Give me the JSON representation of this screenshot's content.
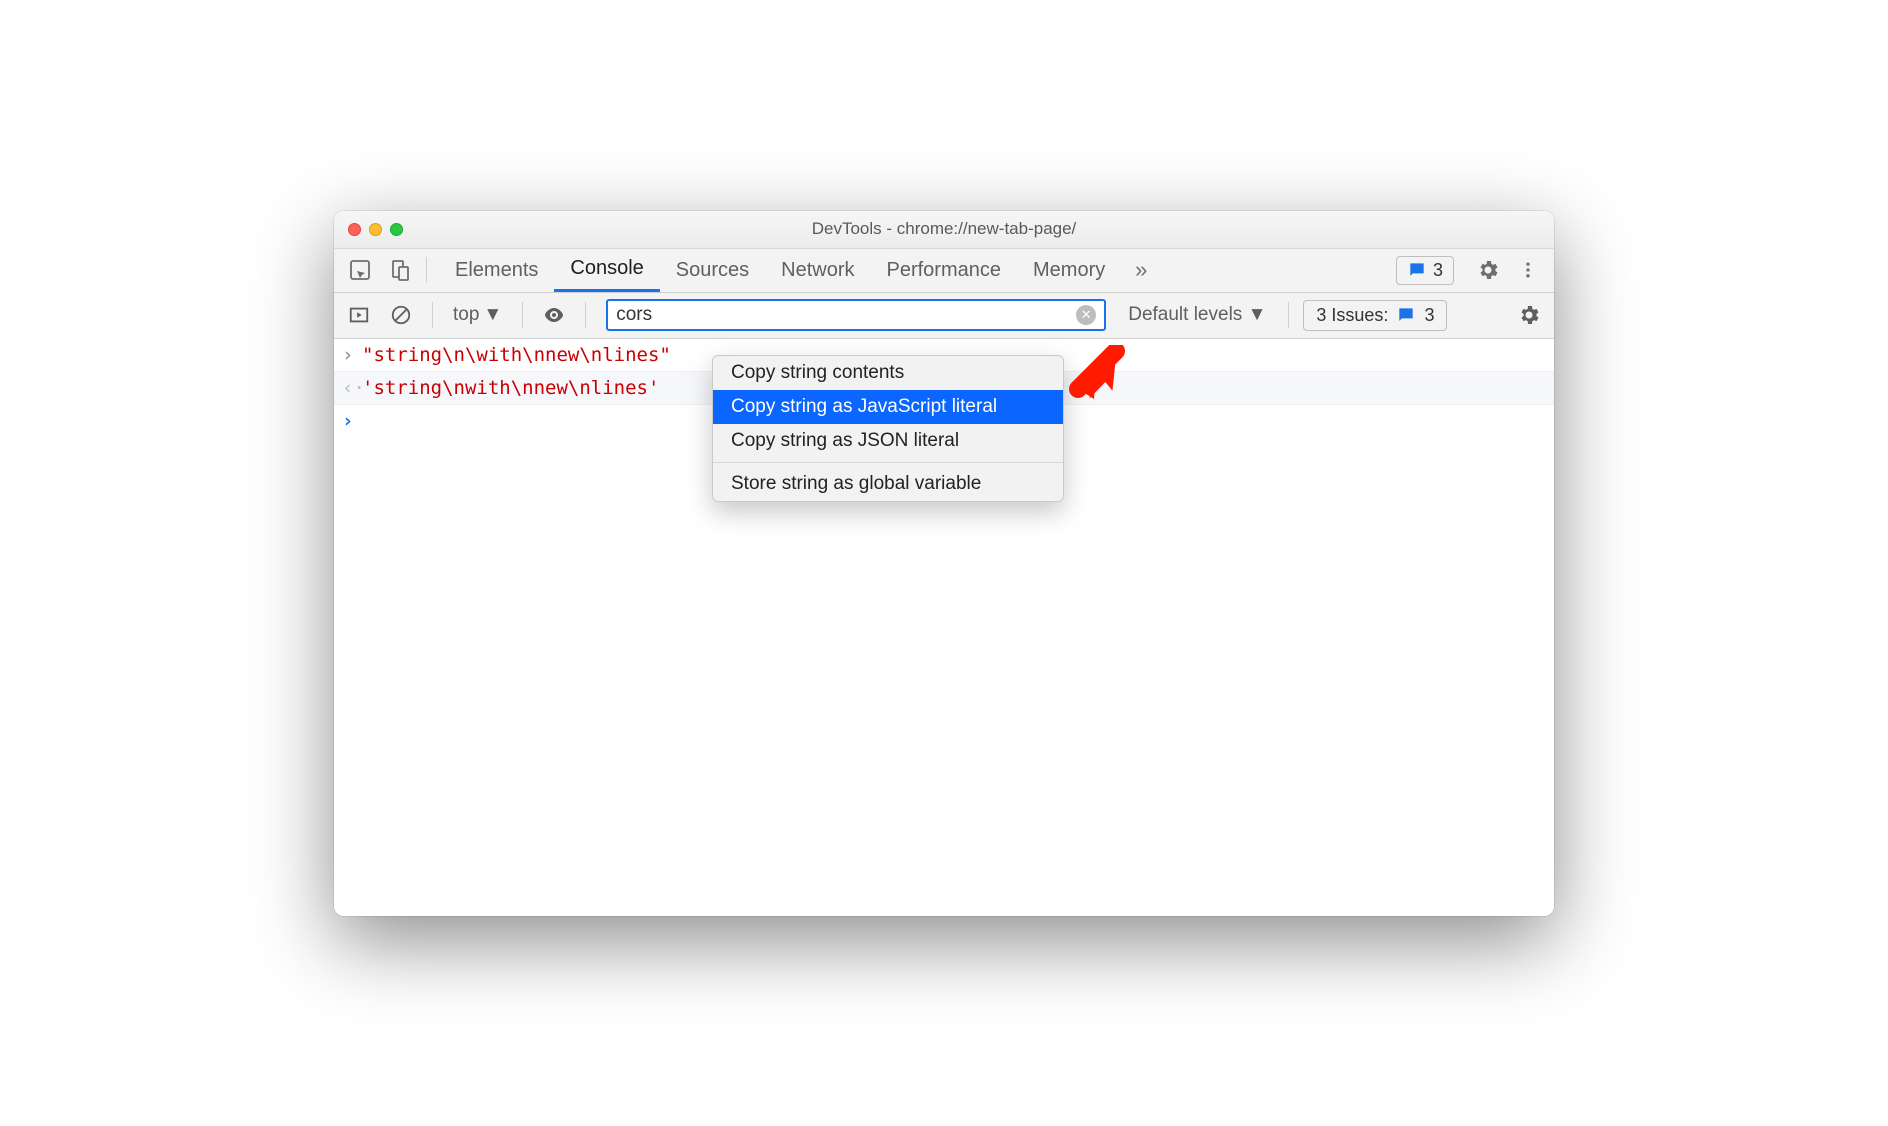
{
  "window": {
    "title": "DevTools - chrome://new-tab-page/"
  },
  "tabs": {
    "items": [
      "Elements",
      "Console",
      "Sources",
      "Network",
      "Performance",
      "Memory"
    ],
    "active": "Console"
  },
  "header": {
    "messages_count": "3"
  },
  "console_toolbar": {
    "context": "top",
    "filter_value": "cors",
    "levels": "Default levels",
    "issues_label": "3 Issues:",
    "issues_count": "3"
  },
  "console": {
    "input_line": "\"string\\n\\with\\nnew\\nlines\"",
    "output_line": "'string\\nwith\\nnew\\nlines'"
  },
  "context_menu": {
    "items": [
      {
        "label": "Copy string contents",
        "selected": false
      },
      {
        "label": "Copy string as JavaScript literal",
        "selected": true
      },
      {
        "label": "Copy string as JSON literal",
        "selected": false
      }
    ],
    "items2": [
      {
        "label": "Store string as global variable",
        "selected": false
      }
    ]
  }
}
